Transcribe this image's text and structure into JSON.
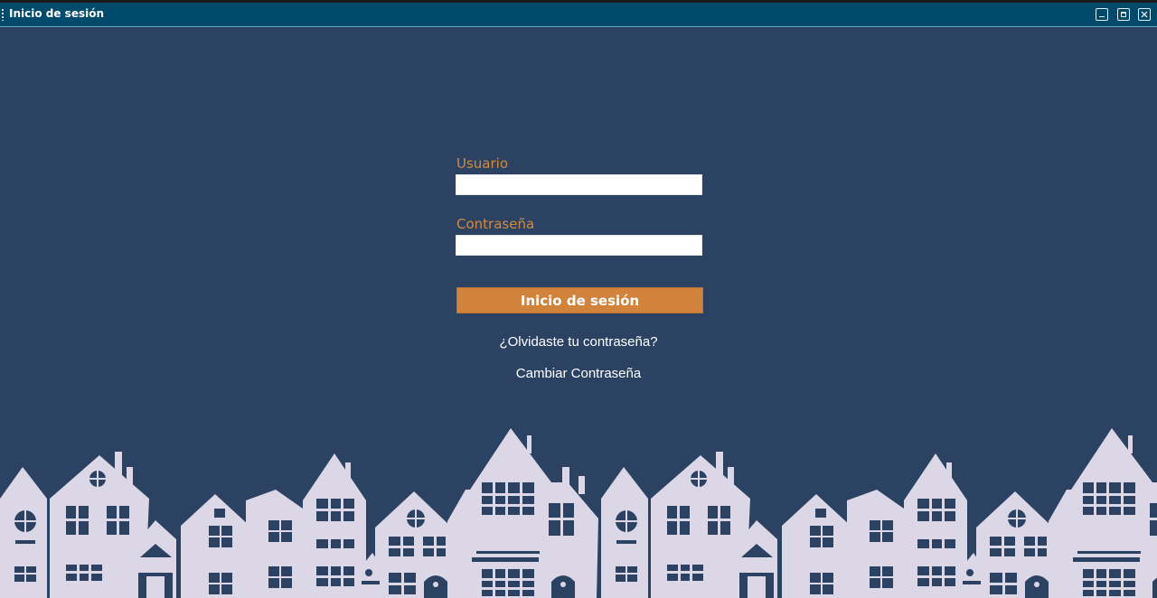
{
  "window": {
    "title": "Inicio de sesión"
  },
  "form": {
    "username_label": "Usuario",
    "username_value": "",
    "password_label": "Contraseña",
    "password_value": "",
    "submit_label": "Inicio de sesión",
    "forgot_password_link": "¿Olvidaste tu contraseña?",
    "change_password_link": "Cambiar Contraseña"
  },
  "colors": {
    "background": "#2b4263",
    "titlebar": "#004a6c",
    "accent": "#d1833c",
    "houses": "#dcd7e6"
  }
}
